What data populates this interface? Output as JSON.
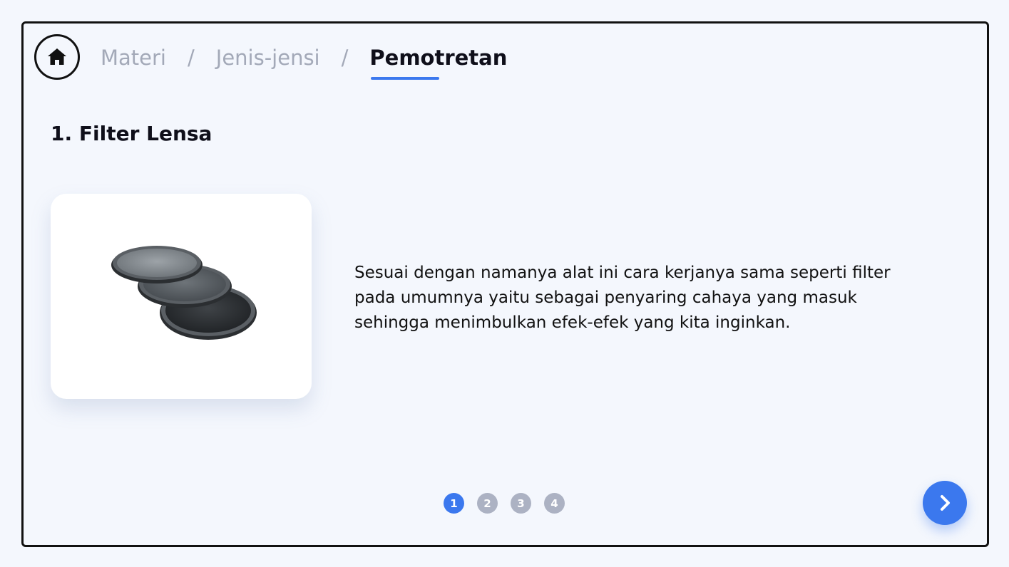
{
  "header": {
    "home_icon": "home-icon",
    "breadcrumb": {
      "items": [
        "Materi",
        "Jenis-jensi"
      ],
      "separator": "/",
      "current": "Pemotretan"
    }
  },
  "main": {
    "title": "1. Filter Lensa",
    "image": "lens-filters-image",
    "description": "Sesuai dengan namanya alat ini cara kerjanya sama seperti filter pada umumnya yaitu sebagai penyaring cahaya yang masuk sehingga menimbulkan efek-efek yang kita inginkan."
  },
  "pagination": {
    "pages": [
      "1",
      "2",
      "3",
      "4"
    ],
    "active": "1"
  },
  "next_icon": "chevron-right-icon",
  "colors": {
    "accent": "#3b78ee",
    "inactive_dot": "#acb2c3",
    "background": "#f4f7fd",
    "muted_text": "#a3a9b8"
  }
}
